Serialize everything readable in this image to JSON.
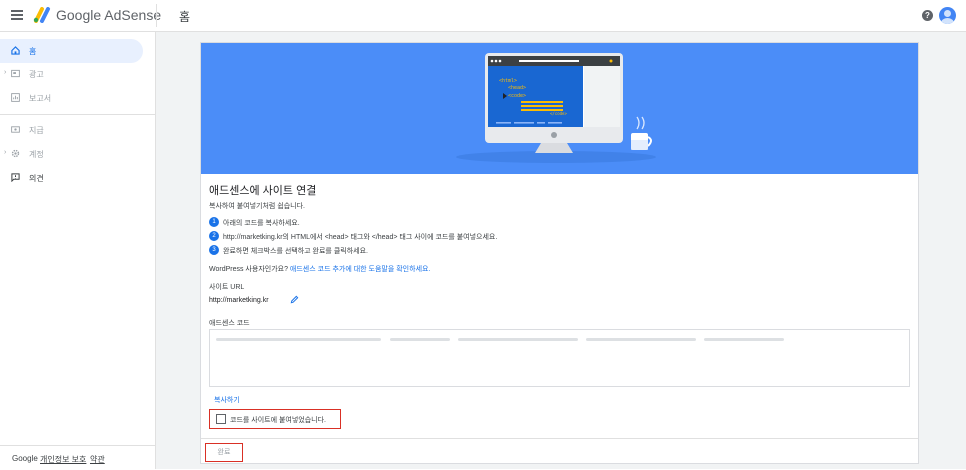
{
  "header": {
    "brand_google": "Google",
    "brand_product": "AdSense",
    "page_title": "홈",
    "help_symbol": "?",
    "icons": [
      "menu-icon",
      "adsense-logo-icon",
      "help-icon",
      "avatar"
    ]
  },
  "sidebar": {
    "items": [
      {
        "label": "홈",
        "icon": "home-icon",
        "active": true
      },
      {
        "label": "광고",
        "icon": "ads-icon",
        "expandable": true
      },
      {
        "label": "보고서",
        "icon": "report-icon"
      },
      {
        "label": "지급",
        "icon": "payments-icon"
      },
      {
        "label": "계정",
        "icon": "settings-icon",
        "expandable": true
      },
      {
        "label": "의견",
        "icon": "feedback-icon"
      }
    ],
    "footer": {
      "google": "Google",
      "privacy": "개인정보 보호",
      "terms": "약관"
    }
  },
  "card": {
    "hero": {
      "code_lines": [
        "<html>",
        "<head>",
        "<code>",
        "</code>"
      ]
    },
    "title": "애드센스에 사이트 연결",
    "subtitle": "복사하여 붙여넣기처럼 쉽습니다.",
    "steps": [
      {
        "num": "1",
        "text": "아래의 코드를 복사하세요."
      },
      {
        "num": "2",
        "text": "http://marketking.kr의 HTML에서 <head> 태그와 </head> 태그 사이에 코드를 붙여넣으세요."
      },
      {
        "num": "3",
        "text": "완료하면 체크박스를 선택하고 완료를 클릭하세요."
      }
    ],
    "wordpress_prefix": "WordPress 사용자인가요? ",
    "wordpress_link": "애드센스 코드 추가에 대한 도움말을 확인하세요.",
    "site_url_label": "사이트 URL",
    "site_url": "http://marketking.kr",
    "code_label": "애드센스 코드",
    "copy_label": "복사하기",
    "confirm_label": "코드를 사이트에 붙여넣었습니다.",
    "done_label": "완료",
    "colors": {
      "hero": "#4b8df8",
      "accent": "#1a73e8",
      "highlight_border": "#d93025"
    }
  }
}
